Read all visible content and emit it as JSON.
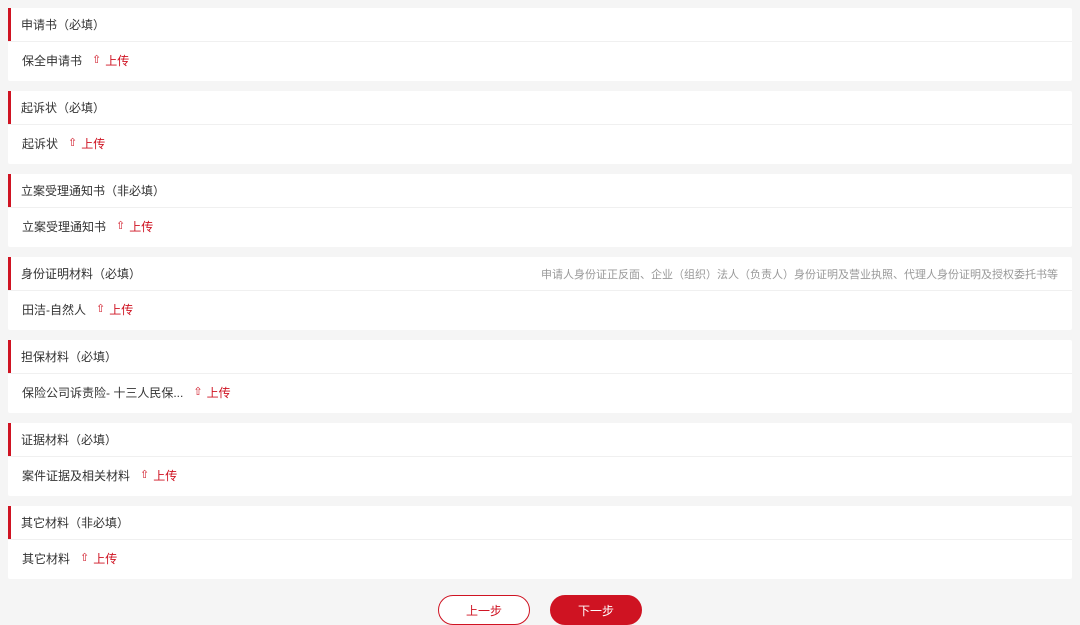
{
  "sections": [
    {
      "title": "申请书（必填）",
      "hint": "",
      "rowLabel": "保全申请书",
      "upload": "上传"
    },
    {
      "title": "起诉状（必填）",
      "hint": "",
      "rowLabel": "起诉状",
      "upload": "上传"
    },
    {
      "title": "立案受理通知书（非必填）",
      "hint": "",
      "rowLabel": "立案受理通知书",
      "upload": "上传"
    },
    {
      "title": "身份证明材料（必填）",
      "hint": "申请人身份证正反面、企业（组织）法人（负责人）身份证明及营业执照、代理人身份证明及授权委托书等",
      "rowLabel": "田洁-自然人",
      "upload": "上传"
    },
    {
      "title": "担保材料（必填）",
      "hint": "",
      "rowLabel": "保险公司诉责险- 十三人民保...",
      "upload": "上传"
    },
    {
      "title": "证据材料（必填）",
      "hint": "",
      "rowLabel": "案件证据及相关材料",
      "upload": "上传"
    },
    {
      "title": "其它材料（非必填）",
      "hint": "",
      "rowLabel": "其它材料",
      "upload": "上传"
    }
  ],
  "footer": {
    "prev": "上一步",
    "next": "下一步"
  }
}
